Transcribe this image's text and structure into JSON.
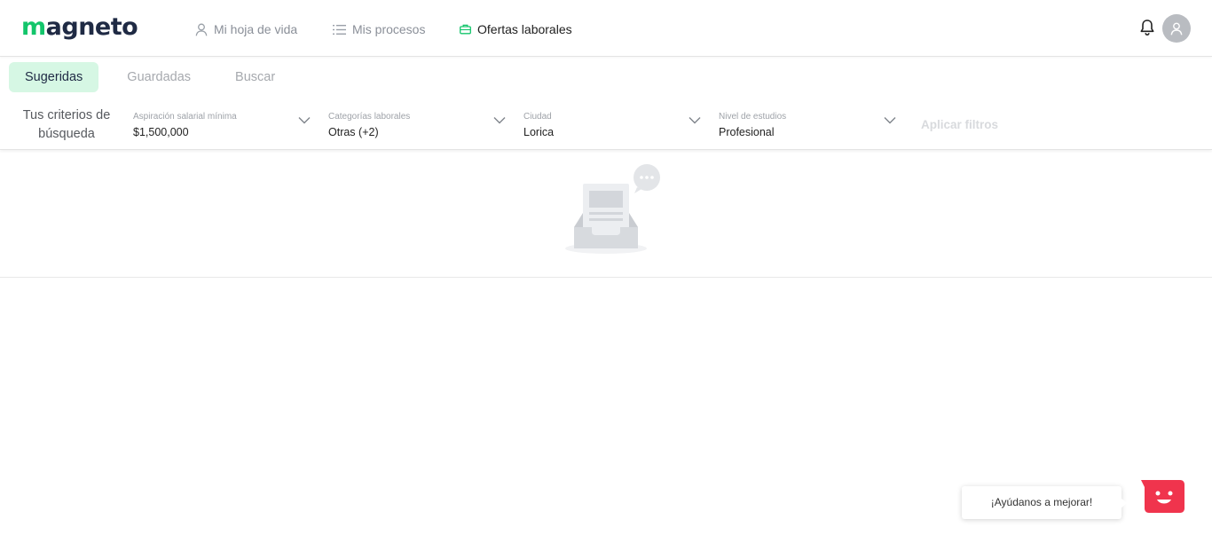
{
  "brand": {
    "logo_prefix": "m",
    "logo_rest": "agneto",
    "accent_color": "#13c56b"
  },
  "nav": {
    "profile_label": "Mi hoja de vida",
    "processes_label": "Mis procesos",
    "offers_label": "Ofertas laborales"
  },
  "tabs": {
    "suggested": "Sugeridas",
    "saved": "Guardadas",
    "search": "Buscar"
  },
  "filters": {
    "criteria_line1": "Tus criterios de",
    "criteria_line2": "búsqueda",
    "salary": {
      "label": "Aspiración salarial mínima",
      "value": "$1,500,000"
    },
    "categories": {
      "label": "Categorías laborales",
      "value": "Otras (+2)"
    },
    "city": {
      "label": "Ciudad",
      "value": "Lorica"
    },
    "education": {
      "label": "Nivel de estudios",
      "value": "Profesional"
    },
    "apply_label": "Aplicar filtros"
  },
  "feedback": {
    "bubble_text": "¡Ayúdanos a mejorar!",
    "button_color": "#f0344d"
  },
  "icons": [
    "user-icon",
    "list-icon",
    "briefcase-icon",
    "bell-icon",
    "avatar-icon",
    "chevron-down-icon",
    "empty-inbox-icon",
    "smiley-icon"
  ]
}
